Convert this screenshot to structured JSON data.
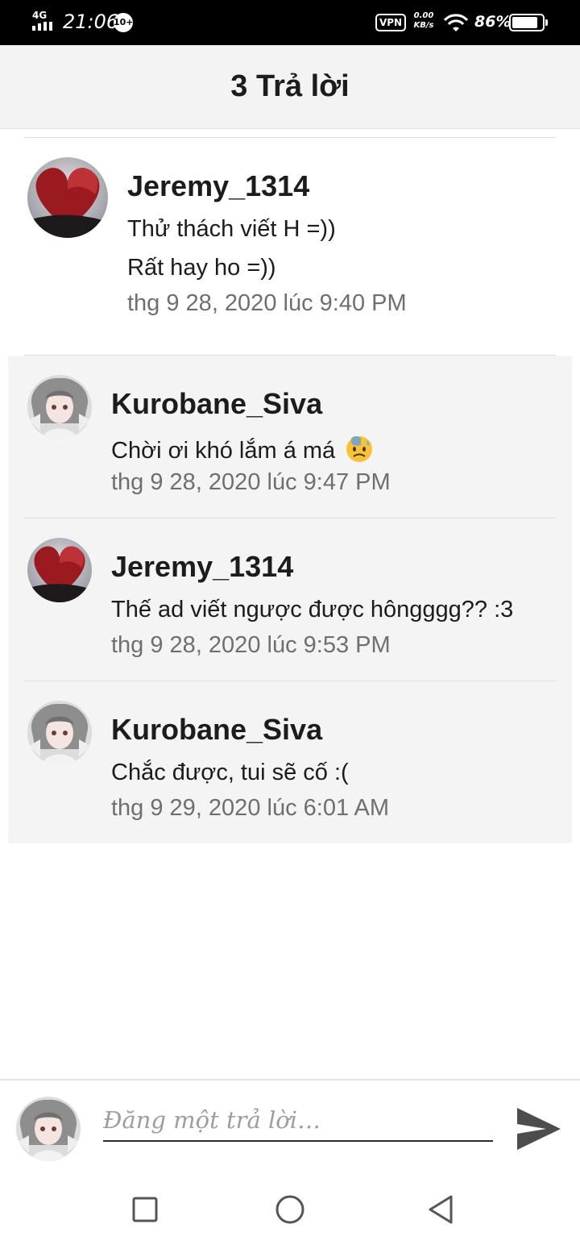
{
  "status_bar": {
    "network": "4G",
    "time": "21:06",
    "notification_badge": "10+",
    "vpn": "VPN",
    "speed_value": "0.00",
    "speed_unit": "KB/s",
    "battery_percent": "86%",
    "battery_level": 0.86
  },
  "header": {
    "title": "3 Trả lời"
  },
  "main_comment": {
    "author": "Jeremy_1314",
    "lines": [
      "Thử thách viết H =))",
      "Rất hay ho =))"
    ],
    "time": "thg 9 28, 2020 lúc 9:40 PM"
  },
  "replies": [
    {
      "author": "Kurobane_Siva",
      "text": "Chời ơi khó lắm á má",
      "emoji": "anxious-face-emoji",
      "time": "thg 9 28, 2020 lúc 9:47 PM"
    },
    {
      "author": "Jeremy_1314",
      "text": "Thế ad viết ngược được hôngggg?? :3",
      "time": "thg 9 28, 2020 lúc 9:53 PM"
    },
    {
      "author": "Kurobane_Siva",
      "text": "Chắc được, tui sẽ cố :(",
      "time": "thg 9 29, 2020 lúc 6:01 AM"
    }
  ],
  "reply_bar": {
    "placeholder": "Đăng một trả lời…",
    "send_icon": "send-icon"
  },
  "nav_bar": {
    "icons": [
      "recents-square-icon",
      "home-circle-icon",
      "back-triangle-icon"
    ]
  },
  "colors": {
    "header_bg": "#f3f3f3",
    "replies_bg": "#f4f4f4",
    "timestamp": "#6f6f6f",
    "send_icon": "#4d4d4d"
  }
}
